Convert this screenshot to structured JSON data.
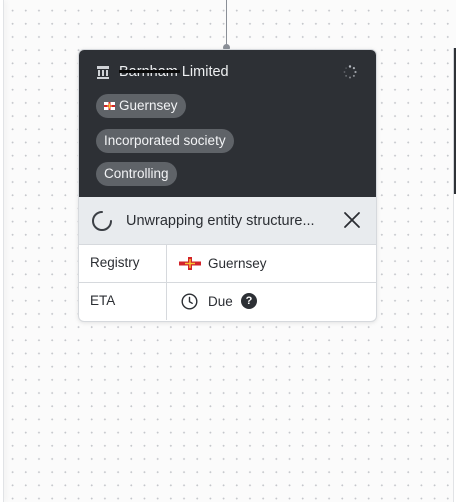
{
  "entity": {
    "name": "Barnham Limited",
    "chips": {
      "jurisdiction": "Guernsey",
      "type": "Incorporated society",
      "role": "Controlling"
    }
  },
  "status": {
    "text": "Unwrapping entity structure..."
  },
  "details": {
    "registry": {
      "label": "Registry",
      "value": "Guernsey"
    },
    "eta": {
      "label": "ETA",
      "value": "Due",
      "help": "?"
    }
  },
  "colors": {
    "card_header": "#2d3035",
    "chip": "#5f6368",
    "status_bar": "#e8ebee",
    "flag_red": "#d2232a",
    "flag_gold": "#f9c535"
  },
  "icons": {
    "entity": "building-icon",
    "spinner": "loading-spinner-icon",
    "close": "close-icon",
    "clock": "clock-icon",
    "help": "help-icon"
  }
}
